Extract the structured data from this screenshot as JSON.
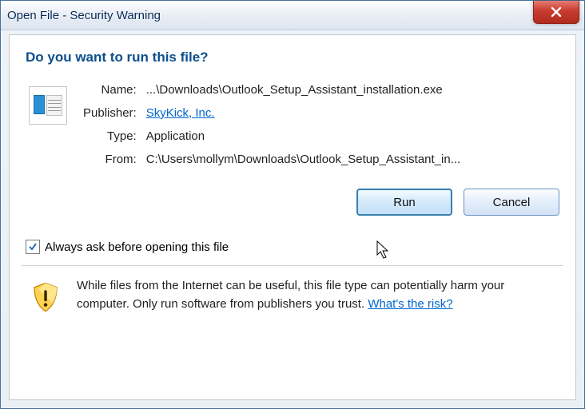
{
  "title": "Open File - Security Warning",
  "heading": "Do you want to run this file?",
  "fields": {
    "name_label": "Name:",
    "name_value": "...\\Downloads\\Outlook_Setup_Assistant_installation.exe",
    "publisher_label": "Publisher:",
    "publisher_value": "SkyKick, Inc.",
    "type_label": "Type:",
    "type_value": "Application",
    "from_label": "From:",
    "from_value": "C:\\Users\\mollym\\Downloads\\Outlook_Setup_Assistant_in..."
  },
  "buttons": {
    "run": "Run",
    "cancel": "Cancel"
  },
  "checkbox": {
    "checked": true,
    "label": "Always ask before opening this file"
  },
  "footer_text": "While files from the Internet can be useful, this file type can potentially harm your computer. Only run software from publishers you trust. ",
  "footer_link": "What's the risk?"
}
